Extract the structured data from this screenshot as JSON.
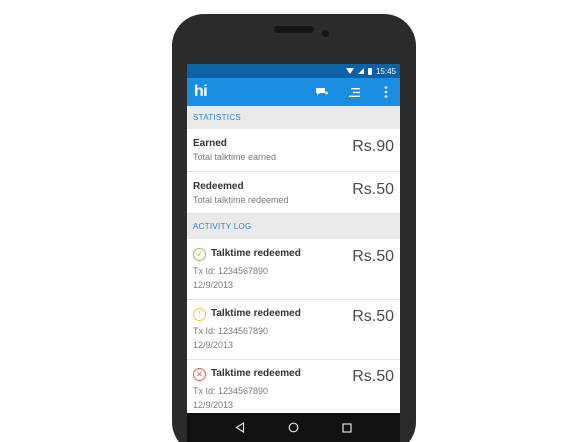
{
  "status_bar": {
    "time": "15:45"
  },
  "app_bar": {
    "logo": "hi"
  },
  "statistics": {
    "header": "STATISTICS",
    "rows": [
      {
        "title": "Earned",
        "subtitle": "Total talktime earned",
        "amount": "Rs.90"
      },
      {
        "title": "Redeemed",
        "subtitle": "Total talktime redeemed",
        "amount": "Rs.50"
      }
    ]
  },
  "activity_log": {
    "header": "ACTIVITY LOG",
    "items": [
      {
        "status": "success",
        "icon": "check-circle-icon",
        "color": "#8dc63f",
        "title": "Talktime redeemed",
        "tx": "Tx Id: 1234567890",
        "date": "12/9/2013",
        "amount": "Rs.50"
      },
      {
        "status": "pending",
        "icon": "warning-circle-icon",
        "color": "#f5c23a",
        "title": "Talktime redeemed",
        "tx": "Tx Id: 1234567890",
        "date": "12/9/2013",
        "amount": "Rs.50"
      },
      {
        "status": "failed",
        "icon": "error-circle-icon",
        "color": "#e8584e",
        "title": "Talktime redeemed",
        "tx": "Tx Id: 1234567890",
        "date": "12/9/2013",
        "amount": "Rs.50"
      }
    ]
  },
  "colors": {
    "app_bar": "#1a8ee1",
    "status_bar": "#0d61a6",
    "section_header_text": "#2b84cf"
  }
}
